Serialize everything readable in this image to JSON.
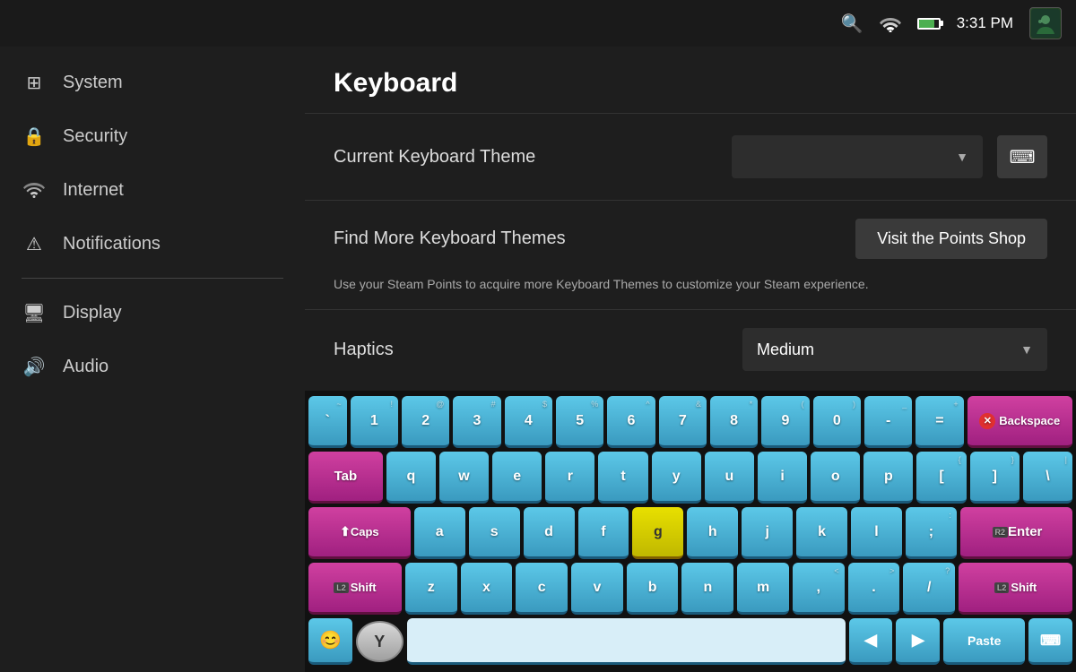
{
  "topbar": {
    "time": "3:31 PM",
    "search_icon": "🔍",
    "wifi_icon": "wifi",
    "battery_level": 80
  },
  "sidebar": {
    "items": [
      {
        "id": "system",
        "label": "System",
        "icon": "🖥"
      },
      {
        "id": "security",
        "label": "Security",
        "icon": "🔒"
      },
      {
        "id": "internet",
        "label": "Internet",
        "icon": "📶"
      },
      {
        "id": "notifications",
        "label": "Notifications",
        "icon": "⚠"
      },
      {
        "id": "display",
        "label": "Display",
        "icon": "🖥"
      },
      {
        "id": "audio",
        "label": "Audio",
        "icon": "🔊"
      }
    ]
  },
  "main": {
    "page_title": "Keyboard",
    "keyboard_theme": {
      "label": "Current Keyboard Theme",
      "value": "",
      "placeholder": ""
    },
    "find_more": {
      "label": "Find More Keyboard Themes",
      "button": "Visit the Points Shop"
    },
    "description": "Use your Steam Points to acquire more Keyboard Themes to customize your Steam experience.",
    "haptics": {
      "label": "Haptics",
      "value": "Medium"
    }
  },
  "keyboard": {
    "rows": [
      {
        "keys": [
          {
            "label": "`",
            "sub": "~",
            "type": "normal"
          },
          {
            "label": "1",
            "sub": "!",
            "type": "normal"
          },
          {
            "label": "2",
            "sub": "@",
            "type": "normal"
          },
          {
            "label": "3",
            "sub": "#",
            "type": "normal"
          },
          {
            "label": "4",
            "sub": "$",
            "type": "normal"
          },
          {
            "label": "5",
            "sub": "%",
            "type": "normal"
          },
          {
            "label": "6",
            "sub": "^",
            "type": "normal"
          },
          {
            "label": "7",
            "sub": "&",
            "type": "normal"
          },
          {
            "label": "8",
            "sub": "*",
            "type": "normal"
          },
          {
            "label": "9",
            "sub": "(",
            "type": "normal"
          },
          {
            "label": "0",
            "sub": ")",
            "type": "normal"
          },
          {
            "label": "-",
            "sub": "_",
            "type": "normal"
          },
          {
            "label": "=",
            "sub": "+",
            "type": "normal"
          },
          {
            "label": "Backspace",
            "type": "backspace"
          }
        ]
      },
      {
        "keys": [
          {
            "label": "Tab",
            "type": "tab"
          },
          {
            "label": "q",
            "type": "normal"
          },
          {
            "label": "w",
            "type": "normal"
          },
          {
            "label": "e",
            "type": "normal"
          },
          {
            "label": "r",
            "type": "normal"
          },
          {
            "label": "t",
            "type": "normal"
          },
          {
            "label": "y",
            "type": "normal"
          },
          {
            "label": "u",
            "type": "normal"
          },
          {
            "label": "i",
            "type": "normal"
          },
          {
            "label": "o",
            "type": "normal"
          },
          {
            "label": "p",
            "type": "normal"
          },
          {
            "label": "[",
            "sub": "{",
            "type": "normal"
          },
          {
            "label": "]",
            "sub": "}",
            "type": "normal"
          },
          {
            "label": "\\",
            "sub": "|",
            "type": "normal"
          }
        ]
      },
      {
        "keys": [
          {
            "label": "Caps",
            "type": "caps"
          },
          {
            "label": "a",
            "type": "normal"
          },
          {
            "label": "s",
            "type": "normal"
          },
          {
            "label": "d",
            "type": "normal"
          },
          {
            "label": "f",
            "type": "normal"
          },
          {
            "label": "g",
            "type": "yellow"
          },
          {
            "label": "h",
            "type": "normal"
          },
          {
            "label": "j",
            "type": "normal"
          },
          {
            "label": "k",
            "type": "normal"
          },
          {
            "label": "l",
            "type": "normal"
          },
          {
            "label": ";",
            "sub": ":",
            "type": "normal"
          },
          {
            "label": "Enter",
            "type": "enter"
          }
        ]
      },
      {
        "keys": [
          {
            "label": "Shift",
            "type": "shift"
          },
          {
            "label": "z",
            "type": "normal"
          },
          {
            "label": "x",
            "type": "normal"
          },
          {
            "label": "c",
            "type": "normal"
          },
          {
            "label": "v",
            "type": "normal"
          },
          {
            "label": "b",
            "type": "normal"
          },
          {
            "label": "n",
            "type": "normal"
          },
          {
            "label": "m",
            "type": "normal"
          },
          {
            "label": ",",
            "sub": "<",
            "type": "normal"
          },
          {
            "label": ".",
            "sub": ">",
            "type": "normal"
          },
          {
            "label": "/",
            "sub": "?",
            "type": "normal"
          },
          {
            "label": "Shift",
            "type": "shift-r"
          }
        ]
      }
    ],
    "bottom_row": {
      "emoji": "😊",
      "y_button": "Y",
      "space_value": "",
      "left_arrow": "◀",
      "right_arrow": "▶",
      "paste": "Paste",
      "kbd": "⌨"
    }
  }
}
